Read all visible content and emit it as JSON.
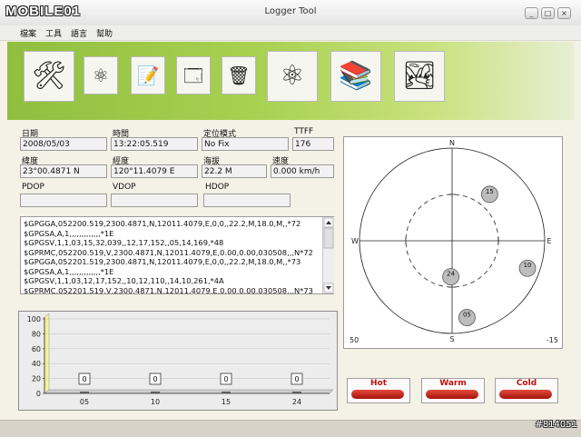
{
  "window": {
    "logo": "MOBILE01",
    "title": "Logger Tool",
    "min": "_",
    "max": "□",
    "close": "×"
  },
  "menu": [
    "檔案",
    "工具",
    "語言",
    "幫助"
  ],
  "toolbar": [
    {
      "icon": "settings-tools-icon",
      "glyph": "🛠",
      "big": true
    },
    {
      "icon": "molecule-icon",
      "glyph": "⚛",
      "big": false
    },
    {
      "icon": "document-edit-icon",
      "glyph": "📝",
      "big": false
    },
    {
      "icon": "window-icon",
      "glyph": "🗔",
      "big": false
    },
    {
      "icon": "clear-icon",
      "glyph": "🗑",
      "big": false
    },
    {
      "icon": "satellite-atom-icon",
      "glyph": "⚛",
      "big": true
    },
    {
      "icon": "documents-stack-icon",
      "glyph": "📚",
      "big": true
    },
    {
      "icon": "map-photo-icon",
      "glyph": "🏞",
      "big": true
    }
  ],
  "fields": {
    "date": {
      "label": "日期",
      "value": "2008/05/03"
    },
    "time": {
      "label": "時間",
      "value": "13:22:05.519"
    },
    "fix_mode": {
      "label": "定位模式",
      "value": "No Fix"
    },
    "ttff": {
      "label": "TTFF",
      "value": "176"
    },
    "latitude": {
      "label": "緯度",
      "value": "23°00.4871 N"
    },
    "longitude": {
      "label": "經度",
      "value": "120°11.4079 E"
    },
    "altitude": {
      "label": "海拔",
      "value": "22.2 M"
    },
    "speed": {
      "label": "速度",
      "value": "0.000 km/h"
    },
    "pdop": {
      "label": "PDOP",
      "value": ""
    },
    "vdop": {
      "label": "VDOP",
      "value": ""
    },
    "hdop": {
      "label": "HDOP",
      "value": ""
    }
  },
  "nmea_lines": [
    "$GPGGA,052200.519,2300.4871,N,12011.4079,E,0,0,,22.2,M,18.0,M,,*72",
    "$GPGSA,A,1,,,,,,,,,,,,,*1E",
    "$GPGSV,1,1,03,15,32,039,,12,17,152,,05,14,169,*48",
    "$GPRMC,052200.519,V,2300.4871,N,12011.4079,E,0.00,0.00,030508,,,N*72",
    "$GPGGA,052201.519,2300.4871,N,12011.4079,E,0,0,,22.2,M,18.0,M,,*73",
    "$GPGSA,A,1,,,,,,,,,,,,,*1E",
    "$GPGSV,1,1,03,12,17,152,,10,12,110,,14,10,261,*4A",
    "$GPRMC,052201.519,V,2300.4871,N,12011.4079,E,0.00,0.00,030508,,,N*73"
  ],
  "chart_data": {
    "type": "bar",
    "categories": [
      "05",
      "10",
      "15",
      "24"
    ],
    "values": [
      0,
      0,
      0,
      0
    ],
    "ylim": [
      0,
      100
    ],
    "yticks": [
      0,
      20,
      40,
      60,
      80,
      100
    ]
  },
  "sky": {
    "north": "N",
    "south": "S",
    "east": "E",
    "west": "W",
    "left_bottom": "50",
    "right_bottom": "-15",
    "satellites": [
      {
        "prn": "15",
        "az": 39,
        "el": 32
      },
      {
        "prn": "10",
        "az": 110,
        "el": 12
      },
      {
        "prn": "24",
        "az": 182,
        "el": 55
      },
      {
        "prn": "05",
        "az": 169,
        "el": 14
      }
    ]
  },
  "buttons": {
    "hot": "Hot",
    "warm": "Warm",
    "cold": "Cold"
  },
  "watermark": "#814051"
}
